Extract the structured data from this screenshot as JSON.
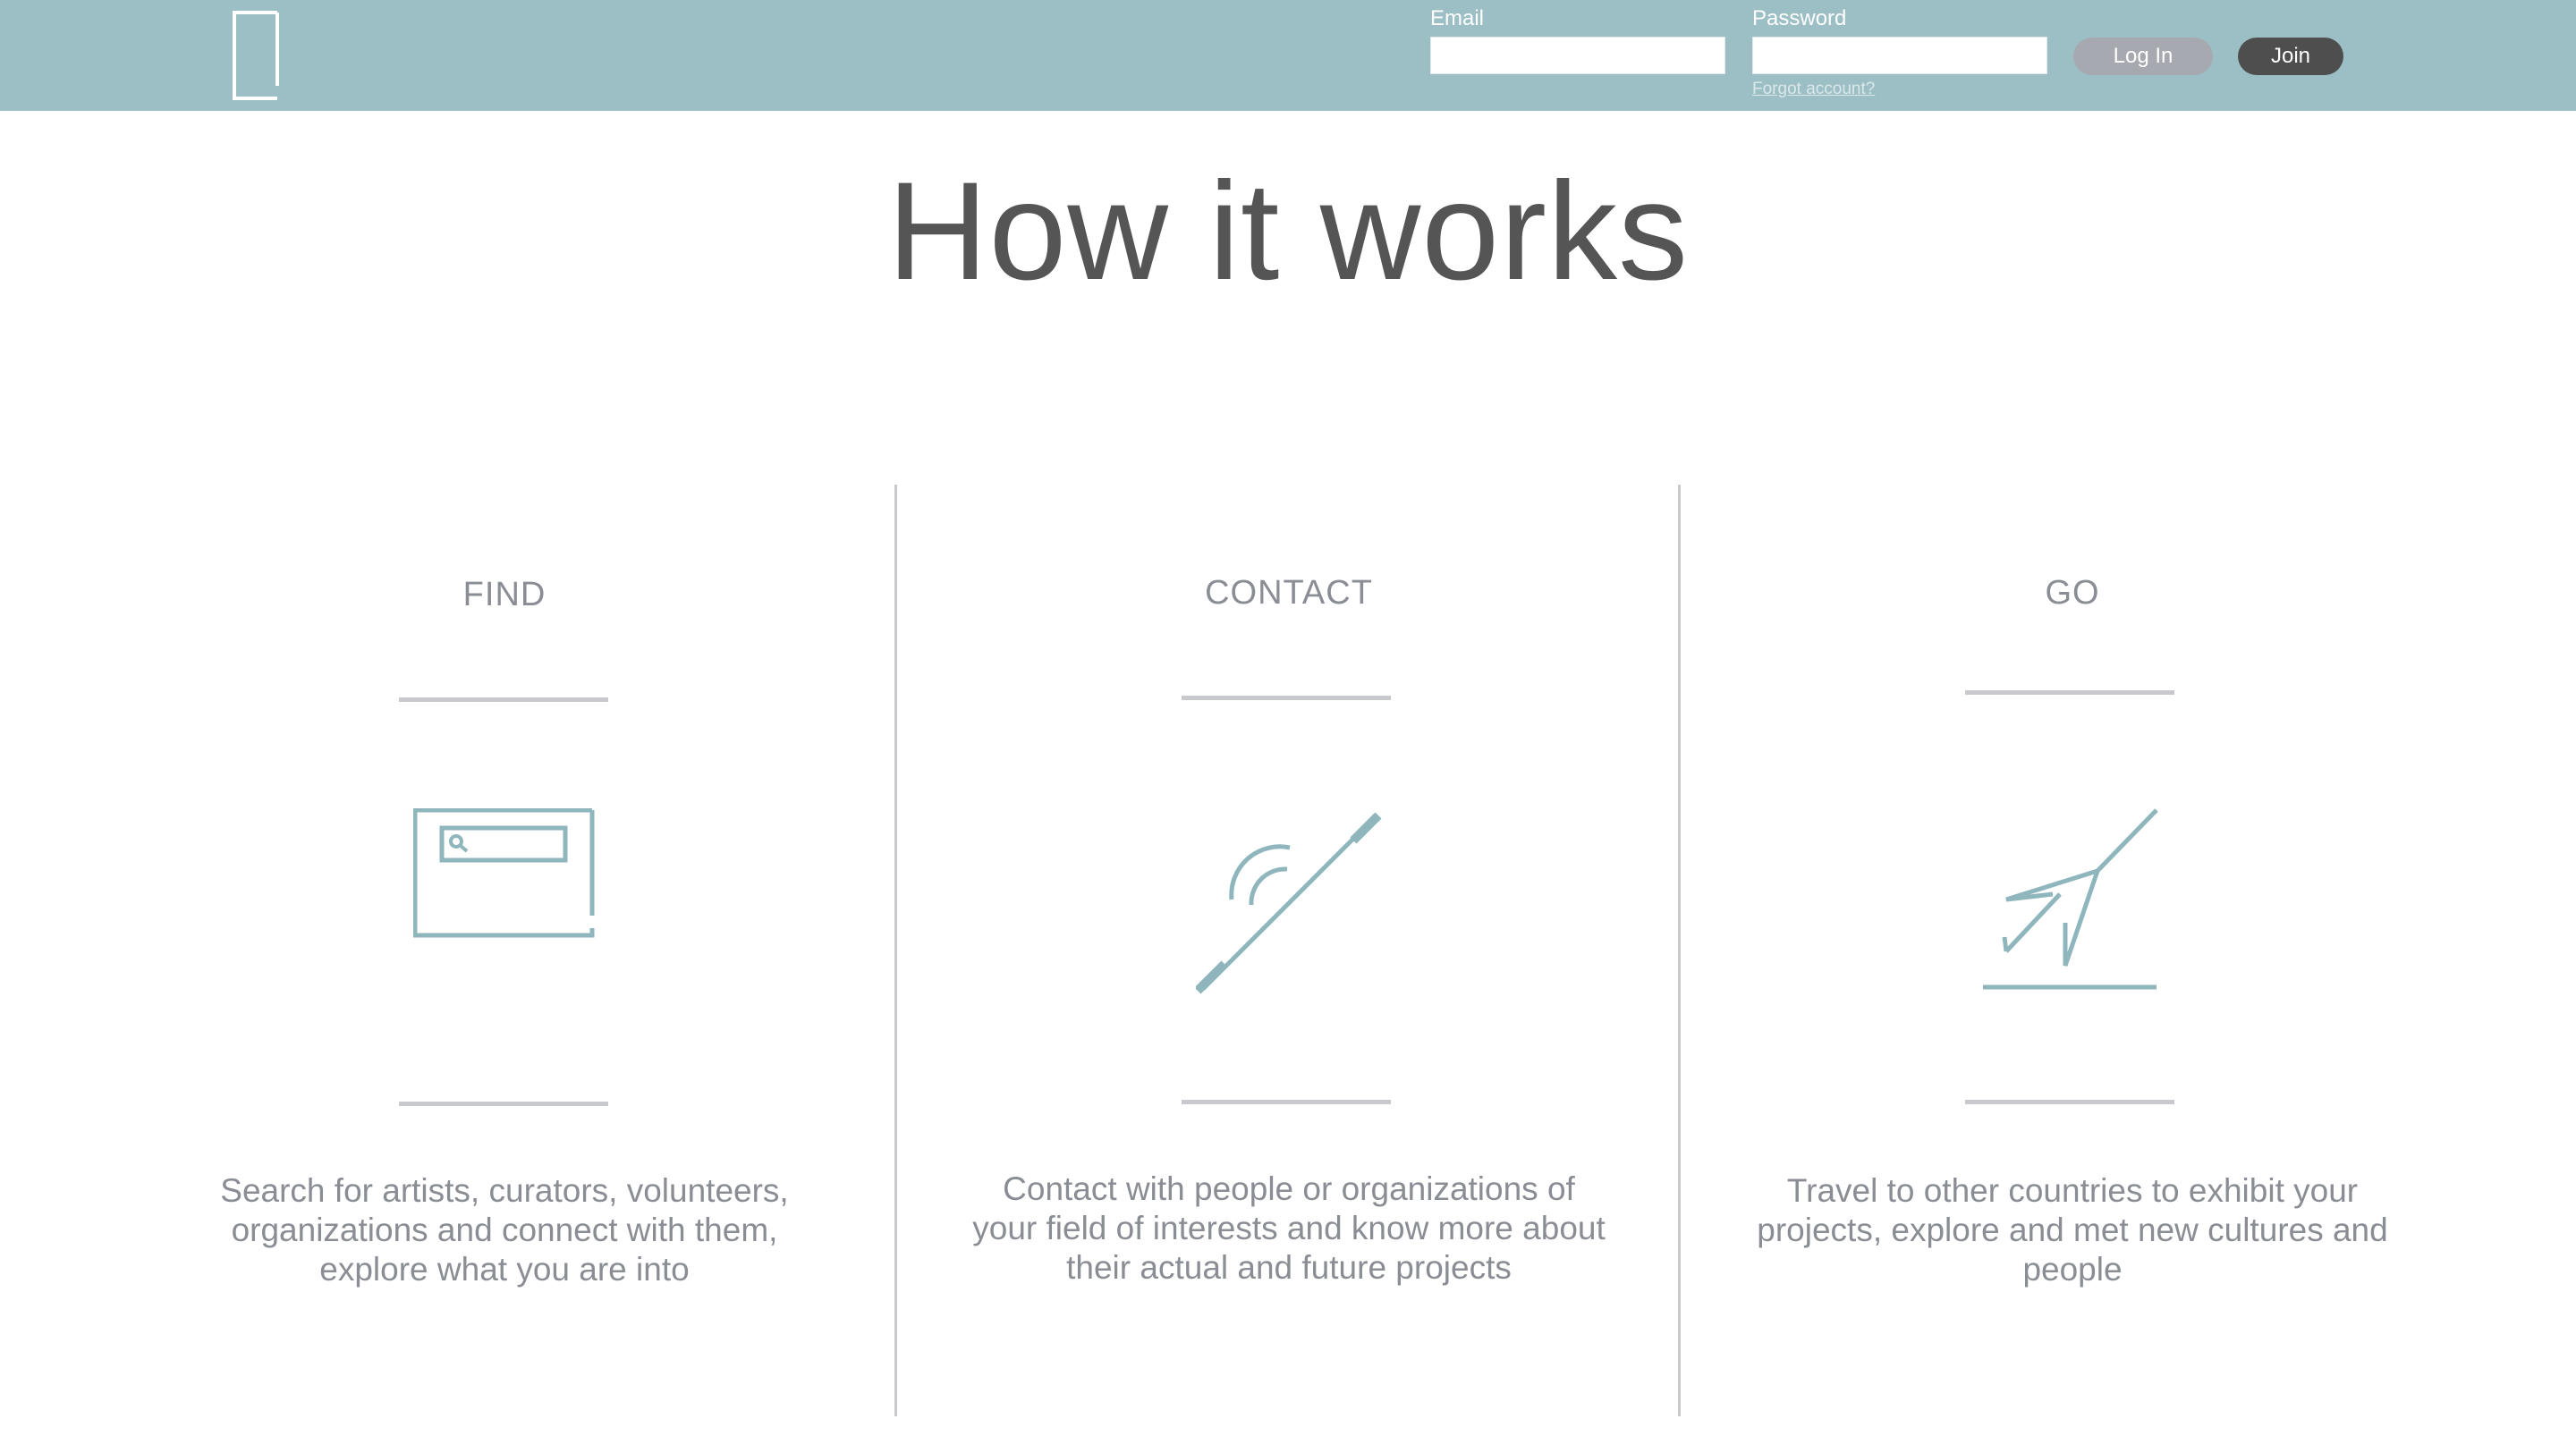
{
  "header": {
    "email_label": "Email",
    "email_value": "",
    "password_label": "Password",
    "password_value": "",
    "forgot_label": "Forgot account?",
    "login_label": "Log In",
    "join_label": "Join",
    "logo_icon": "door-icon",
    "bar_color": "#9bbfc4"
  },
  "main": {
    "title": "How it works",
    "steps": [
      {
        "title": "FIND",
        "icon": "search-browser-icon",
        "description": "Search for artists, curators, volunteers, organizations and connect with them, explore what you are into"
      },
      {
        "title": "CONTACT",
        "icon": "phone-signal-icon",
        "description": "Contact with people or organizations of your field of interests and know more about their actual and future projects"
      },
      {
        "title": "GO",
        "icon": "paper-plane-icon",
        "description": "Travel to other countries to exhibit your projects, explore and met new cultures and people"
      }
    ]
  },
  "colors": {
    "accent": "#8fb6bc",
    "text_dark": "#555555",
    "text_muted": "#8a8d94",
    "rule": "#c8c9cc"
  }
}
